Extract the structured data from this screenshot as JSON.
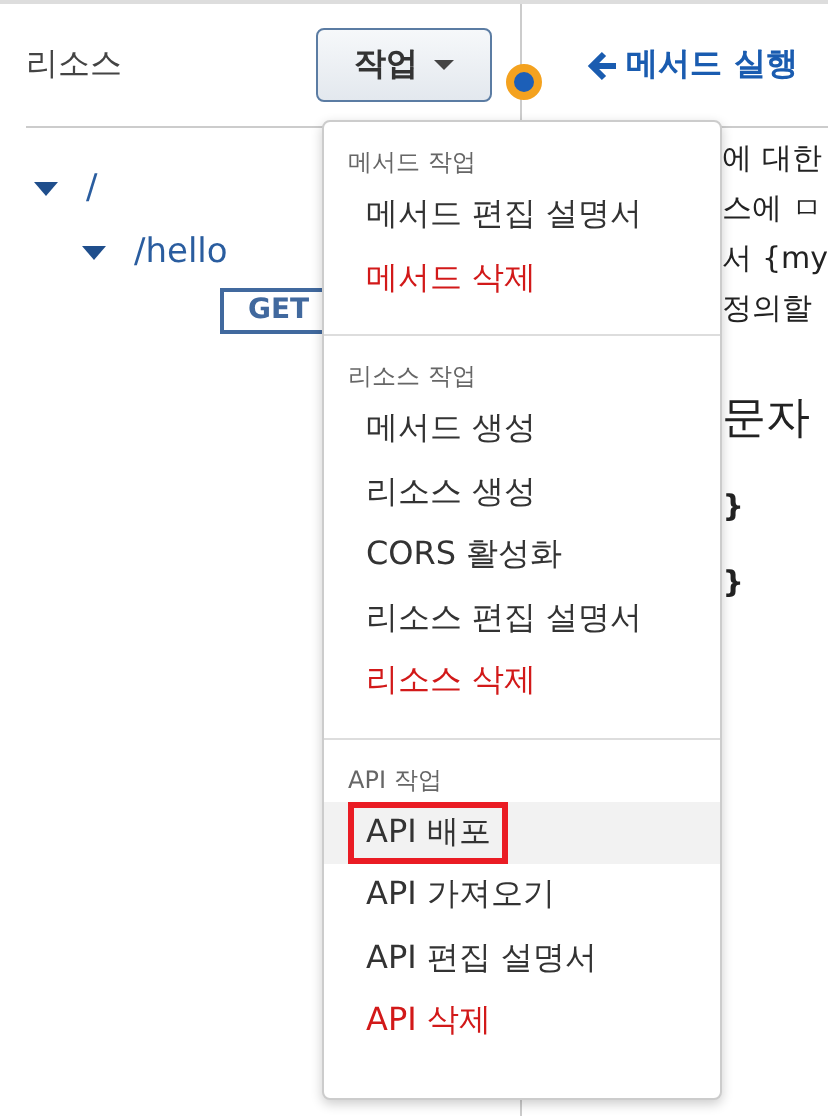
{
  "left_panel": {
    "title": "리소스",
    "actions_button": "작업",
    "tree": [
      {
        "label": "/",
        "expanded": true,
        "children": [
          {
            "label": "/hello",
            "expanded": true,
            "children": [
              {
                "label": "GET",
                "kind": "method",
                "selected": true
              }
            ]
          }
        ]
      }
    ]
  },
  "right_panel": {
    "back_link": "메서드 실행",
    "fragments": [
      {
        "text": "에 대한",
        "kind": "body"
      },
      {
        "text": "스에 ㅁ",
        "kind": "body"
      },
      {
        "text": "서 {my",
        "kind": "body"
      },
      {
        "text": "정의할",
        "kind": "body"
      },
      {
        "text": "문자",
        "kind": "heading"
      },
      {
        "text": "}",
        "kind": "code"
      },
      {
        "text": "}",
        "kind": "code"
      }
    ]
  },
  "menu": {
    "sections": [
      {
        "heading": "메서드 작업",
        "items": [
          {
            "label": "메서드 편집 설명서",
            "danger": false,
            "highlighted": false
          },
          {
            "label": "메서드 삭제",
            "danger": true,
            "highlighted": false
          }
        ]
      },
      {
        "heading": "리소스 작업",
        "items": [
          {
            "label": "메서드 생성",
            "danger": false,
            "highlighted": false
          },
          {
            "label": "리소스 생성",
            "danger": false,
            "highlighted": false
          },
          {
            "label": "CORS 활성화",
            "danger": false,
            "highlighted": false
          },
          {
            "label": "리소스 편집 설명서",
            "danger": false,
            "highlighted": false
          },
          {
            "label": "리소스 삭제",
            "danger": true,
            "highlighted": false
          }
        ]
      },
      {
        "heading": "API 작업",
        "items": [
          {
            "label": "API 배포",
            "danger": false,
            "highlighted": true
          },
          {
            "label": "API 가져오기",
            "danger": false,
            "highlighted": false
          },
          {
            "label": "API 편집 설명서",
            "danger": false,
            "highlighted": false
          },
          {
            "label": "API 삭제",
            "danger": true,
            "highlighted": false
          }
        ]
      }
    ]
  }
}
